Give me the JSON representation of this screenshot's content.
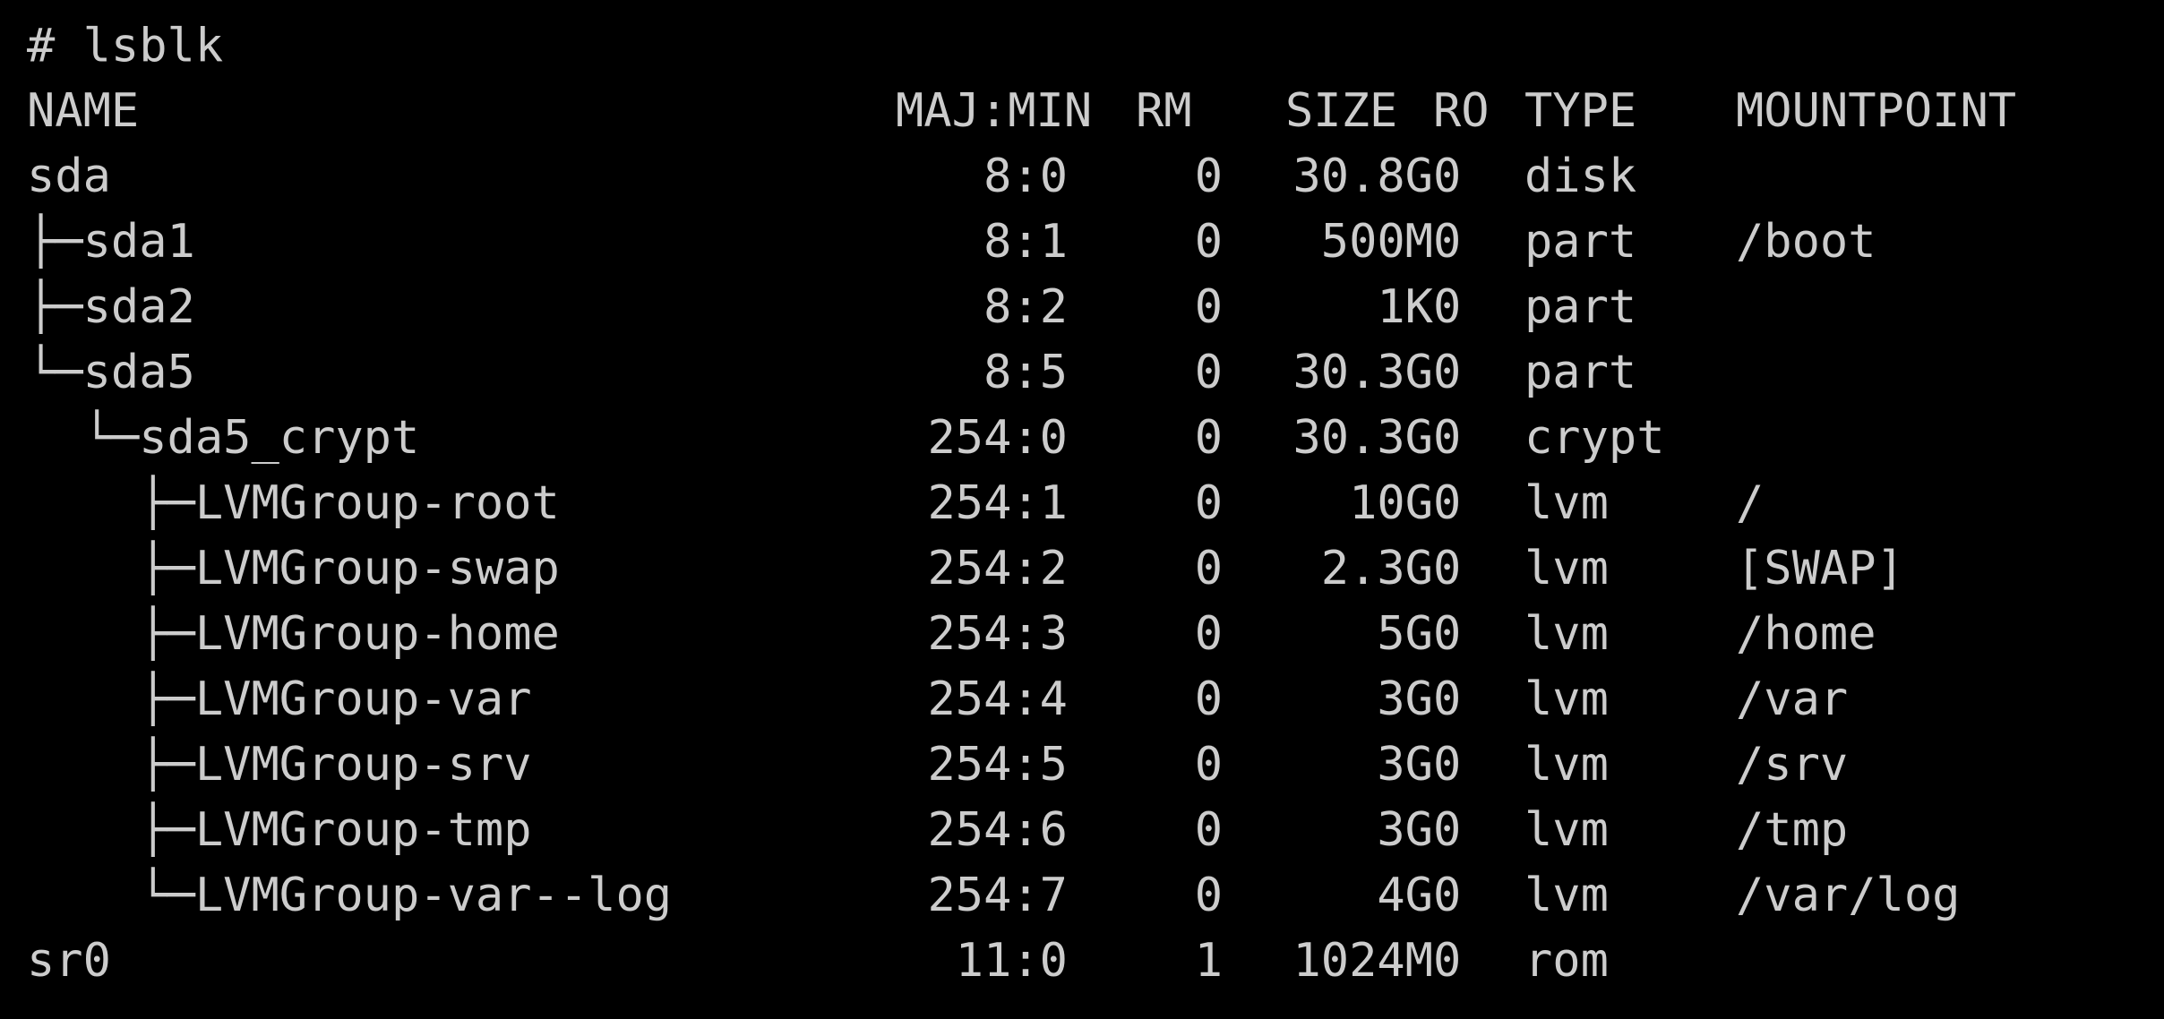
{
  "terminal": {
    "prompt": "# lsblk",
    "headers": {
      "name": "NAME",
      "majmin": "MAJ:MIN",
      "rm": "RM",
      "size": "SIZE",
      "ro": "RO",
      "type": "TYPE",
      "mountpoint": "MOUNTPOINT"
    },
    "rows": [
      {
        "name": "sda",
        "majmin": "8:0",
        "rm": "0",
        "size": "30.8G",
        "ro": "0",
        "type": "disk",
        "mountpoint": ""
      },
      {
        "name": "├─sda1",
        "majmin": "8:1",
        "rm": "0",
        "size": "500M",
        "ro": "0",
        "type": "part",
        "mountpoint": "/boot"
      },
      {
        "name": "├─sda2",
        "majmin": "8:2",
        "rm": "0",
        "size": "1K",
        "ro": "0",
        "type": "part",
        "mountpoint": ""
      },
      {
        "name": "└─sda5",
        "majmin": "8:5",
        "rm": "0",
        "size": "30.3G",
        "ro": "0",
        "type": "part",
        "mountpoint": ""
      },
      {
        "name": "  └─sda5_crypt",
        "majmin": "254:0",
        "rm": "0",
        "size": "30.3G",
        "ro": "0",
        "type": "crypt",
        "mountpoint": ""
      },
      {
        "name": "    ├─LVMGroup-root",
        "majmin": "254:1",
        "rm": "0",
        "size": "10G",
        "ro": "0",
        "type": "lvm",
        "mountpoint": "/"
      },
      {
        "name": "    ├─LVMGroup-swap",
        "majmin": "254:2",
        "rm": "0",
        "size": "2.3G",
        "ro": "0",
        "type": "lvm",
        "mountpoint": "[SWAP]"
      },
      {
        "name": "    ├─LVMGroup-home",
        "majmin": "254:3",
        "rm": "0",
        "size": "5G",
        "ro": "0",
        "type": "lvm",
        "mountpoint": "/home"
      },
      {
        "name": "    ├─LVMGroup-var",
        "majmin": "254:4",
        "rm": "0",
        "size": "3G",
        "ro": "0",
        "type": "lvm",
        "mountpoint": "/var"
      },
      {
        "name": "    ├─LVMGroup-srv",
        "majmin": "254:5",
        "rm": "0",
        "size": "3G",
        "ro": "0",
        "type": "lvm",
        "mountpoint": "/srv"
      },
      {
        "name": "    ├─LVMGroup-tmp",
        "majmin": "254:6",
        "rm": "0",
        "size": "3G",
        "ro": "0",
        "type": "lvm",
        "mountpoint": "/tmp"
      },
      {
        "name": "    └─LVMGroup-var--log",
        "majmin": "254:7",
        "rm": "0",
        "size": "4G",
        "ro": "0",
        "type": "lvm",
        "mountpoint": "/var/log"
      },
      {
        "name": "sr0",
        "majmin": "11:0",
        "rm": "1",
        "size": "1024M",
        "ro": "0",
        "type": "rom",
        "mountpoint": ""
      }
    ]
  },
  "colors": {
    "background": "#000000",
    "foreground": "#cccccc"
  }
}
